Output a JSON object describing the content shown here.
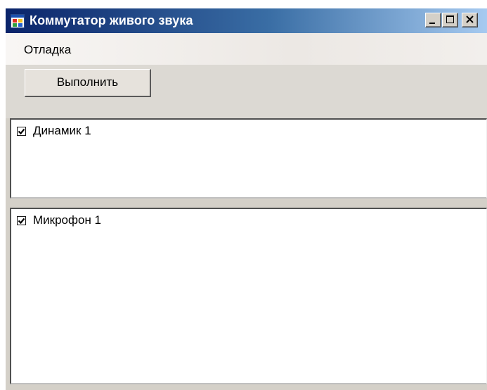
{
  "window": {
    "title": "Коммутатор живого звука",
    "controls": [
      "minimize-icon",
      "maximize-icon",
      "close-icon"
    ]
  },
  "menu": {
    "items": [
      {
        "label": "Отладка"
      }
    ]
  },
  "toolbar": {
    "run_label": "Выполнить"
  },
  "speakers": {
    "items": [
      {
        "label": "Динамик 1",
        "checked": true
      }
    ]
  },
  "microphones": {
    "items": [
      {
        "label": "Микрофон 1",
        "checked": true
      }
    ]
  },
  "colors": {
    "title_start": "#0a246a",
    "title_end": "#a6caf0",
    "face": "#d4d0c8"
  }
}
